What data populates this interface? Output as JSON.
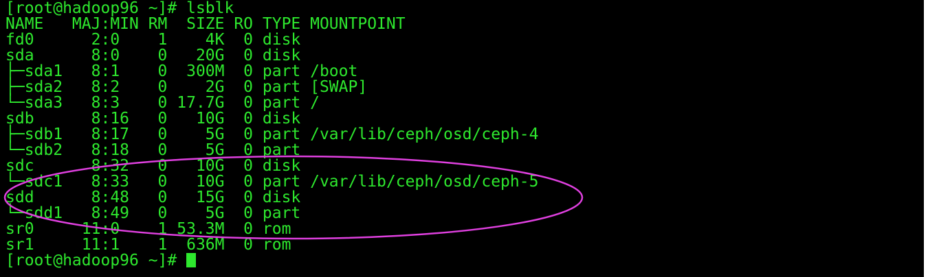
{
  "terminal": {
    "text_color": "#2ee82e",
    "background_color": "#000000",
    "lines": [
      "[root@hadoop96 ~]# lsblk",
      "NAME   MAJ:MIN RM  SIZE RO TYPE MOUNTPOINT",
      "fd0      2:0    1    4K  0 disk",
      "sda      8:0    0   20G  0 disk",
      "├─sda1   8:1    0  300M  0 part /boot",
      "├─sda2   8:2    0    2G  0 part [SWAP]",
      "└─sda3   8:3    0 17.7G  0 part /",
      "sdb      8:16   0   10G  0 disk",
      "├─sdb1   8:17   0    5G  0 part /var/lib/ceph/osd/ceph-4",
      "└─sdb2   8:18   0    5G  0 part",
      "sdc      8:32   0   10G  0 disk",
      "└─sdc1   8:33   0   10G  0 part /var/lib/ceph/osd/ceph-5",
      "sdd      8:48   0   15G  0 disk",
      "└─sdd1   8:49   0    5G  0 part",
      "sr0     11:0    1 53.3M  0 rom",
      "sr1     11:1    1  636M  0 rom"
    ],
    "prompt": "[root@hadoop96 ~]# ",
    "cursor": "block-cursor"
  },
  "annotation": {
    "shape": "ellipse",
    "color": "#e040e0"
  }
}
